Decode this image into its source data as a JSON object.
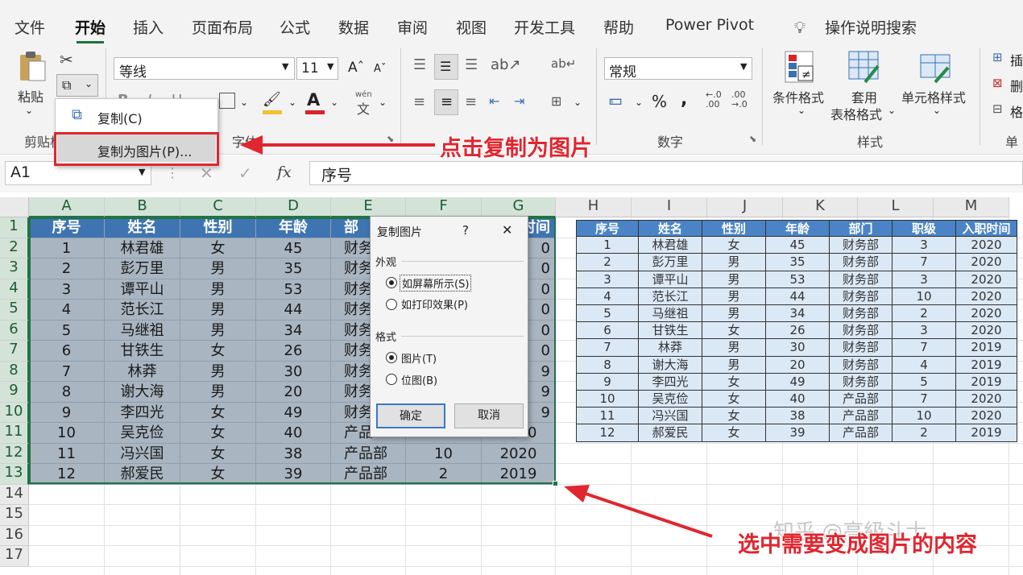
{
  "tabs": [
    "文件",
    "开始",
    "插入",
    "页面布局",
    "公式",
    "数据",
    "审阅",
    "视图",
    "开发工具",
    "帮助",
    "Power Pivot",
    "操作说明搜索"
  ],
  "ribbon": {
    "paste_label": "粘贴",
    "clipboard_label": "剪贴板",
    "font_name": "等线",
    "font_size": "11",
    "font_group_label": "字体",
    "number_format": "常规",
    "number_group_label": "数字",
    "cond_format_label": "条件格式",
    "table_format_label1": "套用",
    "table_format_label2": "表格格式",
    "cell_style_label": "单元格样式",
    "styles_group_label": "样式",
    "insert_label": "插",
    "delete_label": "删",
    "format_label": "格",
    "cells_group_label": "单",
    "wen_label": "wén",
    "wen_char": "文",
    "bold": "B",
    "italic": "I",
    "underline": "U",
    "percent": "%",
    "comma": ",",
    "font_color_letter": "A"
  },
  "dropdown": {
    "copy": "复制(C)",
    "copy_as_picture": "复制为图片(P)..."
  },
  "formula_bar": {
    "name_box": "A1",
    "fx": "fx",
    "formula": "序号"
  },
  "columns": [
    "A",
    "B",
    "C",
    "D",
    "E",
    "F",
    "G",
    "H",
    "I",
    "J",
    "K",
    "L",
    "M"
  ],
  "rows": [
    "1",
    "2",
    "3",
    "4",
    "5",
    "6",
    "7",
    "8",
    "9",
    "10",
    "11",
    "12",
    "13",
    "14",
    "15",
    "16",
    "17"
  ],
  "left_table": {
    "headers": [
      "序号",
      "姓名",
      "性别",
      "年龄",
      "部门",
      "职级",
      "入职时间"
    ],
    "header_visible": [
      "序号",
      "姓名",
      "性别",
      "年龄",
      "部",
      "",
      "时间"
    ],
    "rows": [
      [
        "1",
        "林君雄",
        "女",
        "45",
        "财务",
        "",
        "0"
      ],
      [
        "2",
        "彭万里",
        "男",
        "35",
        "财务",
        "",
        "0"
      ],
      [
        "3",
        "谭平山",
        "男",
        "53",
        "财务",
        "",
        "0"
      ],
      [
        "4",
        "范长江",
        "男",
        "44",
        "财务",
        "",
        "0"
      ],
      [
        "5",
        "马继祖",
        "男",
        "34",
        "财务",
        "",
        "0"
      ],
      [
        "6",
        "甘铁生",
        "女",
        "26",
        "财务",
        "",
        "0"
      ],
      [
        "7",
        "林莽",
        "男",
        "30",
        "财务",
        "",
        "9"
      ],
      [
        "8",
        "谢大海",
        "男",
        "20",
        "财务",
        "",
        "9"
      ],
      [
        "9",
        "李四光",
        "女",
        "49",
        "财务",
        "",
        "9"
      ],
      [
        "10",
        "吴克俭",
        "女",
        "40",
        "产品",
        "",
        "2020"
      ],
      [
        "11",
        "冯兴国",
        "女",
        "38",
        "产品部",
        "10",
        "2020"
      ],
      [
        "12",
        "郝爱民",
        "女",
        "39",
        "产品部",
        "2",
        "2019"
      ]
    ]
  },
  "right_table": {
    "headers": [
      "序号",
      "姓名",
      "性别",
      "年龄",
      "部门",
      "职级",
      "入职时间"
    ],
    "rows": [
      [
        "1",
        "林君雄",
        "女",
        "45",
        "财务部",
        "3",
        "2020"
      ],
      [
        "2",
        "彭万里",
        "男",
        "35",
        "财务部",
        "7",
        "2020"
      ],
      [
        "3",
        "谭平山",
        "男",
        "53",
        "财务部",
        "3",
        "2020"
      ],
      [
        "4",
        "范长江",
        "男",
        "44",
        "财务部",
        "10",
        "2020"
      ],
      [
        "5",
        "马继祖",
        "男",
        "34",
        "财务部",
        "2",
        "2020"
      ],
      [
        "6",
        "甘铁生",
        "女",
        "26",
        "财务部",
        "3",
        "2020"
      ],
      [
        "7",
        "林莽",
        "男",
        "30",
        "财务部",
        "7",
        "2019"
      ],
      [
        "8",
        "谢大海",
        "男",
        "20",
        "财务部",
        "4",
        "2019"
      ],
      [
        "9",
        "李四光",
        "女",
        "49",
        "财务部",
        "5",
        "2019"
      ],
      [
        "10",
        "吴克俭",
        "女",
        "40",
        "产品部",
        "7",
        "2020"
      ],
      [
        "11",
        "冯兴国",
        "女",
        "38",
        "产品部",
        "10",
        "2020"
      ],
      [
        "12",
        "郝爱民",
        "女",
        "39",
        "产品部",
        "2",
        "2019"
      ]
    ]
  },
  "dialog": {
    "title": "复制图片",
    "help": "?",
    "close": "✕",
    "appearance_label": "外观",
    "as_shown_screen": "如屏幕所示(S)",
    "as_shown_print": "如打印效果(P)",
    "format_label": "格式",
    "picture": "图片(T)",
    "bitmap": "位图(B)",
    "ok": "确定",
    "cancel": "取消"
  },
  "annotations": {
    "click_copy_picture": "点击复制为图片",
    "select_content": "选中需要变成图片的内容"
  },
  "watermark": "知乎 @高級斗士",
  "colors": {
    "accent_green": "#217346",
    "annotation_red": "#e0262f",
    "left_header": "#3f74b2",
    "right_header": "#4a84c6"
  }
}
